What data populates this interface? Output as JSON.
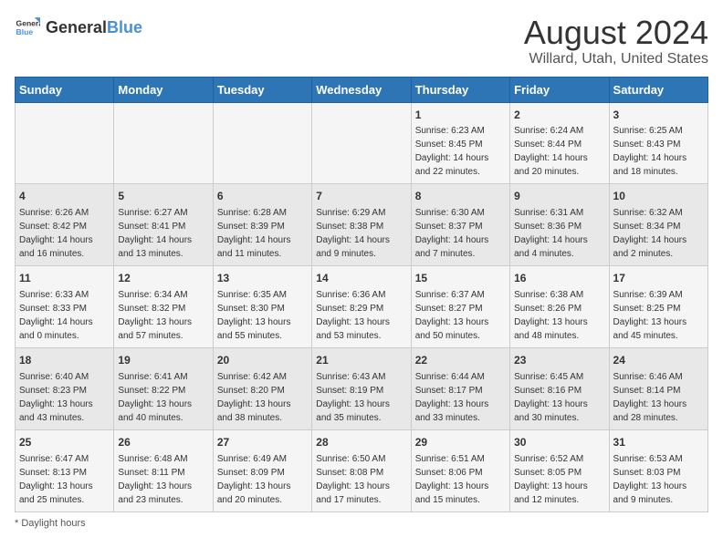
{
  "header": {
    "logo_general": "General",
    "logo_blue": "Blue",
    "month_year": "August 2024",
    "location": "Willard, Utah, United States"
  },
  "days_of_week": [
    "Sunday",
    "Monday",
    "Tuesday",
    "Wednesday",
    "Thursday",
    "Friday",
    "Saturday"
  ],
  "weeks": [
    [
      {
        "day": "",
        "sunrise": "",
        "sunset": "",
        "daylight": ""
      },
      {
        "day": "",
        "sunrise": "",
        "sunset": "",
        "daylight": ""
      },
      {
        "day": "",
        "sunrise": "",
        "sunset": "",
        "daylight": ""
      },
      {
        "day": "",
        "sunrise": "",
        "sunset": "",
        "daylight": ""
      },
      {
        "day": "1",
        "sunrise": "Sunrise: 6:23 AM",
        "sunset": "Sunset: 8:45 PM",
        "daylight": "Daylight: 14 hours and 22 minutes."
      },
      {
        "day": "2",
        "sunrise": "Sunrise: 6:24 AM",
        "sunset": "Sunset: 8:44 PM",
        "daylight": "Daylight: 14 hours and 20 minutes."
      },
      {
        "day": "3",
        "sunrise": "Sunrise: 6:25 AM",
        "sunset": "Sunset: 8:43 PM",
        "daylight": "Daylight: 14 hours and 18 minutes."
      }
    ],
    [
      {
        "day": "4",
        "sunrise": "Sunrise: 6:26 AM",
        "sunset": "Sunset: 8:42 PM",
        "daylight": "Daylight: 14 hours and 16 minutes."
      },
      {
        "day": "5",
        "sunrise": "Sunrise: 6:27 AM",
        "sunset": "Sunset: 8:41 PM",
        "daylight": "Daylight: 14 hours and 13 minutes."
      },
      {
        "day": "6",
        "sunrise": "Sunrise: 6:28 AM",
        "sunset": "Sunset: 8:39 PM",
        "daylight": "Daylight: 14 hours and 11 minutes."
      },
      {
        "day": "7",
        "sunrise": "Sunrise: 6:29 AM",
        "sunset": "Sunset: 8:38 PM",
        "daylight": "Daylight: 14 hours and 9 minutes."
      },
      {
        "day": "8",
        "sunrise": "Sunrise: 6:30 AM",
        "sunset": "Sunset: 8:37 PM",
        "daylight": "Daylight: 14 hours and 7 minutes."
      },
      {
        "day": "9",
        "sunrise": "Sunrise: 6:31 AM",
        "sunset": "Sunset: 8:36 PM",
        "daylight": "Daylight: 14 hours and 4 minutes."
      },
      {
        "day": "10",
        "sunrise": "Sunrise: 6:32 AM",
        "sunset": "Sunset: 8:34 PM",
        "daylight": "Daylight: 14 hours and 2 minutes."
      }
    ],
    [
      {
        "day": "11",
        "sunrise": "Sunrise: 6:33 AM",
        "sunset": "Sunset: 8:33 PM",
        "daylight": "Daylight: 14 hours and 0 minutes."
      },
      {
        "day": "12",
        "sunrise": "Sunrise: 6:34 AM",
        "sunset": "Sunset: 8:32 PM",
        "daylight": "Daylight: 13 hours and 57 minutes."
      },
      {
        "day": "13",
        "sunrise": "Sunrise: 6:35 AM",
        "sunset": "Sunset: 8:30 PM",
        "daylight": "Daylight: 13 hours and 55 minutes."
      },
      {
        "day": "14",
        "sunrise": "Sunrise: 6:36 AM",
        "sunset": "Sunset: 8:29 PM",
        "daylight": "Daylight: 13 hours and 53 minutes."
      },
      {
        "day": "15",
        "sunrise": "Sunrise: 6:37 AM",
        "sunset": "Sunset: 8:27 PM",
        "daylight": "Daylight: 13 hours and 50 minutes."
      },
      {
        "day": "16",
        "sunrise": "Sunrise: 6:38 AM",
        "sunset": "Sunset: 8:26 PM",
        "daylight": "Daylight: 13 hours and 48 minutes."
      },
      {
        "day": "17",
        "sunrise": "Sunrise: 6:39 AM",
        "sunset": "Sunset: 8:25 PM",
        "daylight": "Daylight: 13 hours and 45 minutes."
      }
    ],
    [
      {
        "day": "18",
        "sunrise": "Sunrise: 6:40 AM",
        "sunset": "Sunset: 8:23 PM",
        "daylight": "Daylight: 13 hours and 43 minutes."
      },
      {
        "day": "19",
        "sunrise": "Sunrise: 6:41 AM",
        "sunset": "Sunset: 8:22 PM",
        "daylight": "Daylight: 13 hours and 40 minutes."
      },
      {
        "day": "20",
        "sunrise": "Sunrise: 6:42 AM",
        "sunset": "Sunset: 8:20 PM",
        "daylight": "Daylight: 13 hours and 38 minutes."
      },
      {
        "day": "21",
        "sunrise": "Sunrise: 6:43 AM",
        "sunset": "Sunset: 8:19 PM",
        "daylight": "Daylight: 13 hours and 35 minutes."
      },
      {
        "day": "22",
        "sunrise": "Sunrise: 6:44 AM",
        "sunset": "Sunset: 8:17 PM",
        "daylight": "Daylight: 13 hours and 33 minutes."
      },
      {
        "day": "23",
        "sunrise": "Sunrise: 6:45 AM",
        "sunset": "Sunset: 8:16 PM",
        "daylight": "Daylight: 13 hours and 30 minutes."
      },
      {
        "day": "24",
        "sunrise": "Sunrise: 6:46 AM",
        "sunset": "Sunset: 8:14 PM",
        "daylight": "Daylight: 13 hours and 28 minutes."
      }
    ],
    [
      {
        "day": "25",
        "sunrise": "Sunrise: 6:47 AM",
        "sunset": "Sunset: 8:13 PM",
        "daylight": "Daylight: 13 hours and 25 minutes."
      },
      {
        "day": "26",
        "sunrise": "Sunrise: 6:48 AM",
        "sunset": "Sunset: 8:11 PM",
        "daylight": "Daylight: 13 hours and 23 minutes."
      },
      {
        "day": "27",
        "sunrise": "Sunrise: 6:49 AM",
        "sunset": "Sunset: 8:09 PM",
        "daylight": "Daylight: 13 hours and 20 minutes."
      },
      {
        "day": "28",
        "sunrise": "Sunrise: 6:50 AM",
        "sunset": "Sunset: 8:08 PM",
        "daylight": "Daylight: 13 hours and 17 minutes."
      },
      {
        "day": "29",
        "sunrise": "Sunrise: 6:51 AM",
        "sunset": "Sunset: 8:06 PM",
        "daylight": "Daylight: 13 hours and 15 minutes."
      },
      {
        "day": "30",
        "sunrise": "Sunrise: 6:52 AM",
        "sunset": "Sunset: 8:05 PM",
        "daylight": "Daylight: 13 hours and 12 minutes."
      },
      {
        "day": "31",
        "sunrise": "Sunrise: 6:53 AM",
        "sunset": "Sunset: 8:03 PM",
        "daylight": "Daylight: 13 hours and 9 minutes."
      }
    ]
  ],
  "footer": {
    "daylight_label": "Daylight hours"
  },
  "colors": {
    "header_bg": "#2e75b6",
    "odd_row": "#f5f5f5",
    "even_row": "#e8e8e8"
  }
}
